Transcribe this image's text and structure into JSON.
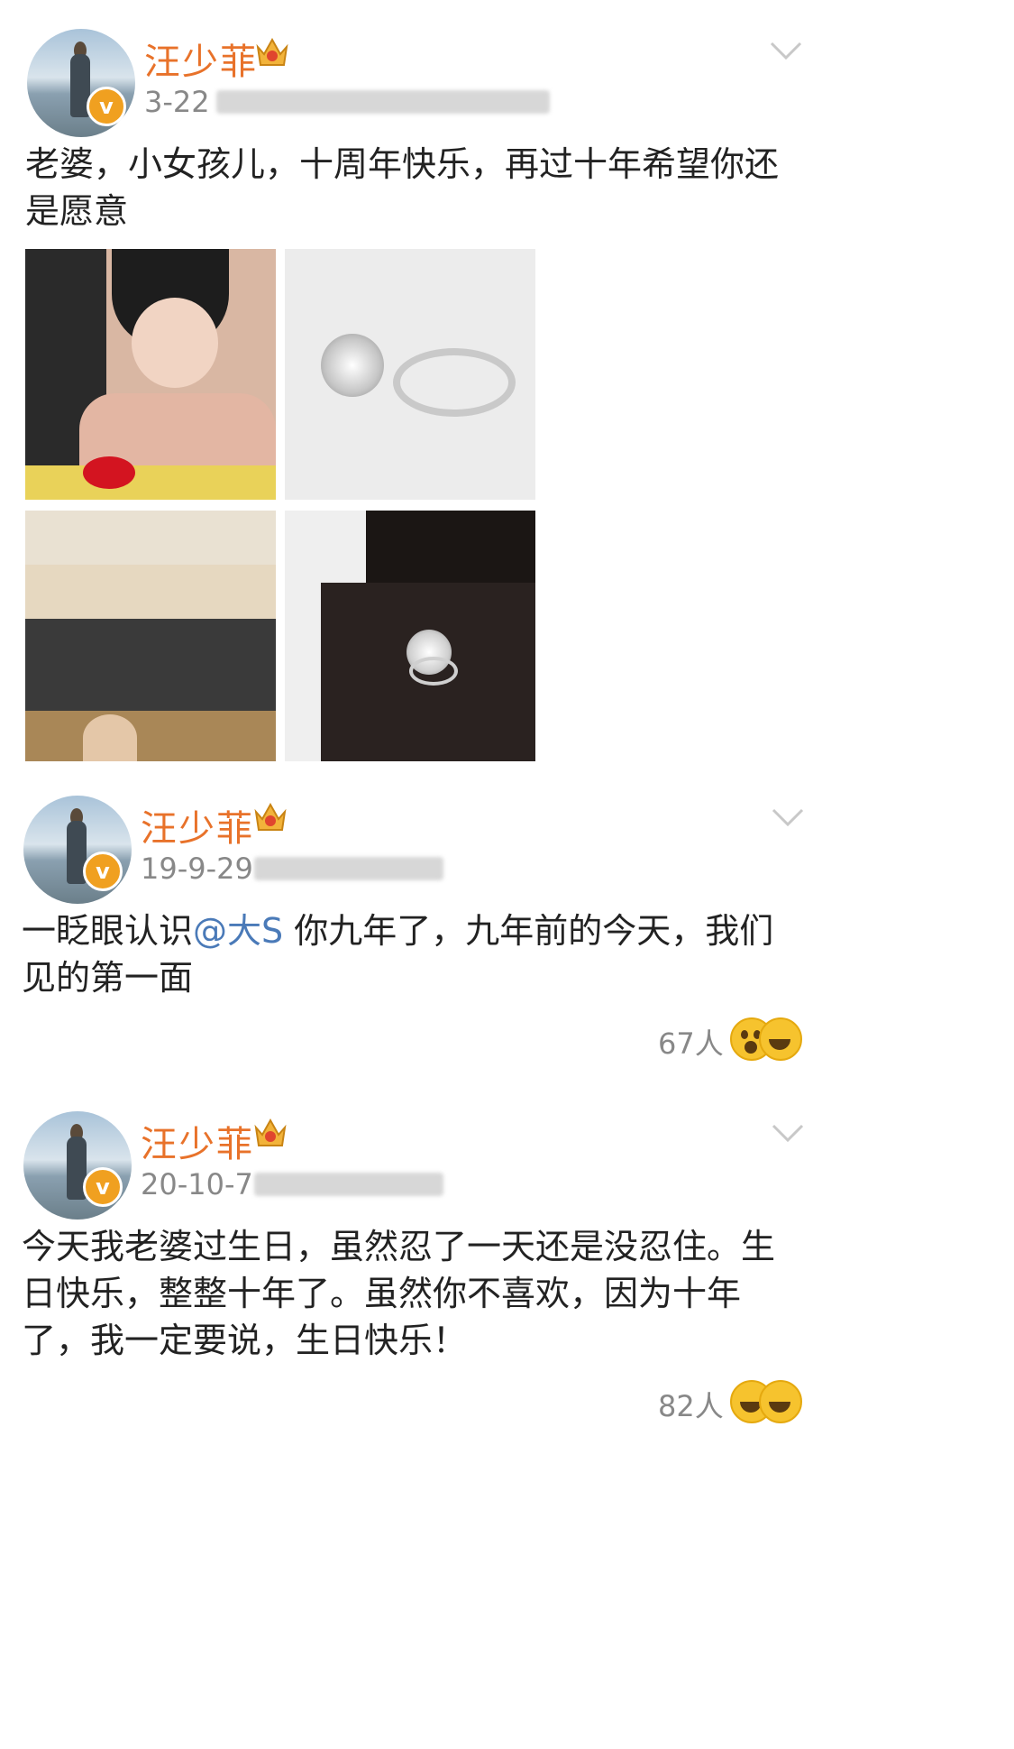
{
  "posts": [
    {
      "author": "汪少菲",
      "date": "3-22",
      "text": "老婆，小女孩儿，十周年快乐，再过十年希望你还是愿意",
      "text_line1": "老婆，小女孩儿，十周年快乐，再过十年希望你还",
      "text_line2": "是愿意",
      "icons": [
        "avatar",
        "verified-icon",
        "crown-icon",
        "chevron-down-icon"
      ],
      "photos": [
        "couple-photo",
        "ring-photo",
        "group-photo",
        "ring-box-photo"
      ]
    },
    {
      "author": "汪少菲",
      "date": "19-9-29",
      "text_line1_before": "一眨眼认识",
      "mention": "@大S",
      "text_line1_after": " 你九年了，九年前的今天，我们",
      "text_line2": "见的第一面",
      "reactions": "67人"
    },
    {
      "author": "汪少菲",
      "date": "20-10-7",
      "text_line1": "今天我老婆过生日，虽然忍了一天还是没忍住。生",
      "text_line2": "日快乐，整整十年了。虽然你不喜欢，因为十年",
      "text_line3": "了，我一定要说，生日快乐！",
      "reactions": "82人"
    }
  ],
  "colors": {
    "name": "#e8722a",
    "mention": "#4a7ab8",
    "meta": "#888888",
    "badge": "#f0a020"
  }
}
